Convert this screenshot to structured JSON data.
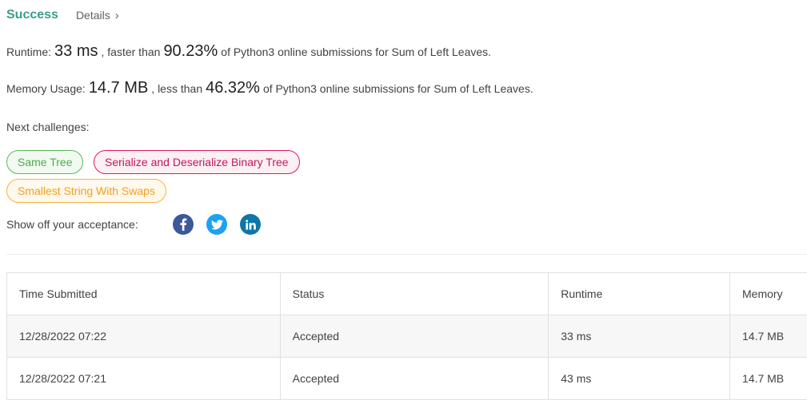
{
  "header": {
    "status": "Success",
    "details_label": "Details",
    "chevron": "›"
  },
  "runtime": {
    "label": "Runtime:",
    "value": "33 ms",
    "comparison": ", faster than",
    "percent": "90.23%",
    "suffix": "of Python3 online submissions for Sum of Left Leaves."
  },
  "memory": {
    "label": "Memory Usage:",
    "value": "14.7 MB",
    "comparison": ", less than",
    "percent": "46.32%",
    "suffix": "of Python3 online submissions for Sum of Left Leaves."
  },
  "next_challenges": {
    "label": "Next challenges:",
    "items": [
      {
        "label": "Same Tree",
        "difficulty": "easy",
        "color": "#5cb85c"
      },
      {
        "label": "Serialize and Deserialize Binary Tree",
        "difficulty": "hard",
        "color": "#d81b60"
      },
      {
        "label": "Smallest String With Swaps",
        "difficulty": "medium",
        "color": "#f5b342"
      }
    ]
  },
  "share": {
    "label": "Show off your acceptance:",
    "icons": [
      "facebook-icon",
      "twitter-icon",
      "linkedin-icon"
    ]
  },
  "table": {
    "headers": [
      "Time Submitted",
      "Status",
      "Runtime",
      "Memory"
    ],
    "rows": [
      {
        "time": "12/28/2022 07:22",
        "status": "Accepted",
        "runtime": "33 ms",
        "memory": "14.7 MB"
      },
      {
        "time": "12/28/2022 07:21",
        "status": "Accepted",
        "runtime": "43 ms",
        "memory": "14.7 MB"
      }
    ]
  },
  "colors": {
    "accent": "#3a9e8a",
    "facebook": "#3b5998",
    "twitter": "#1da1f2",
    "linkedin": "#0e76a8"
  }
}
